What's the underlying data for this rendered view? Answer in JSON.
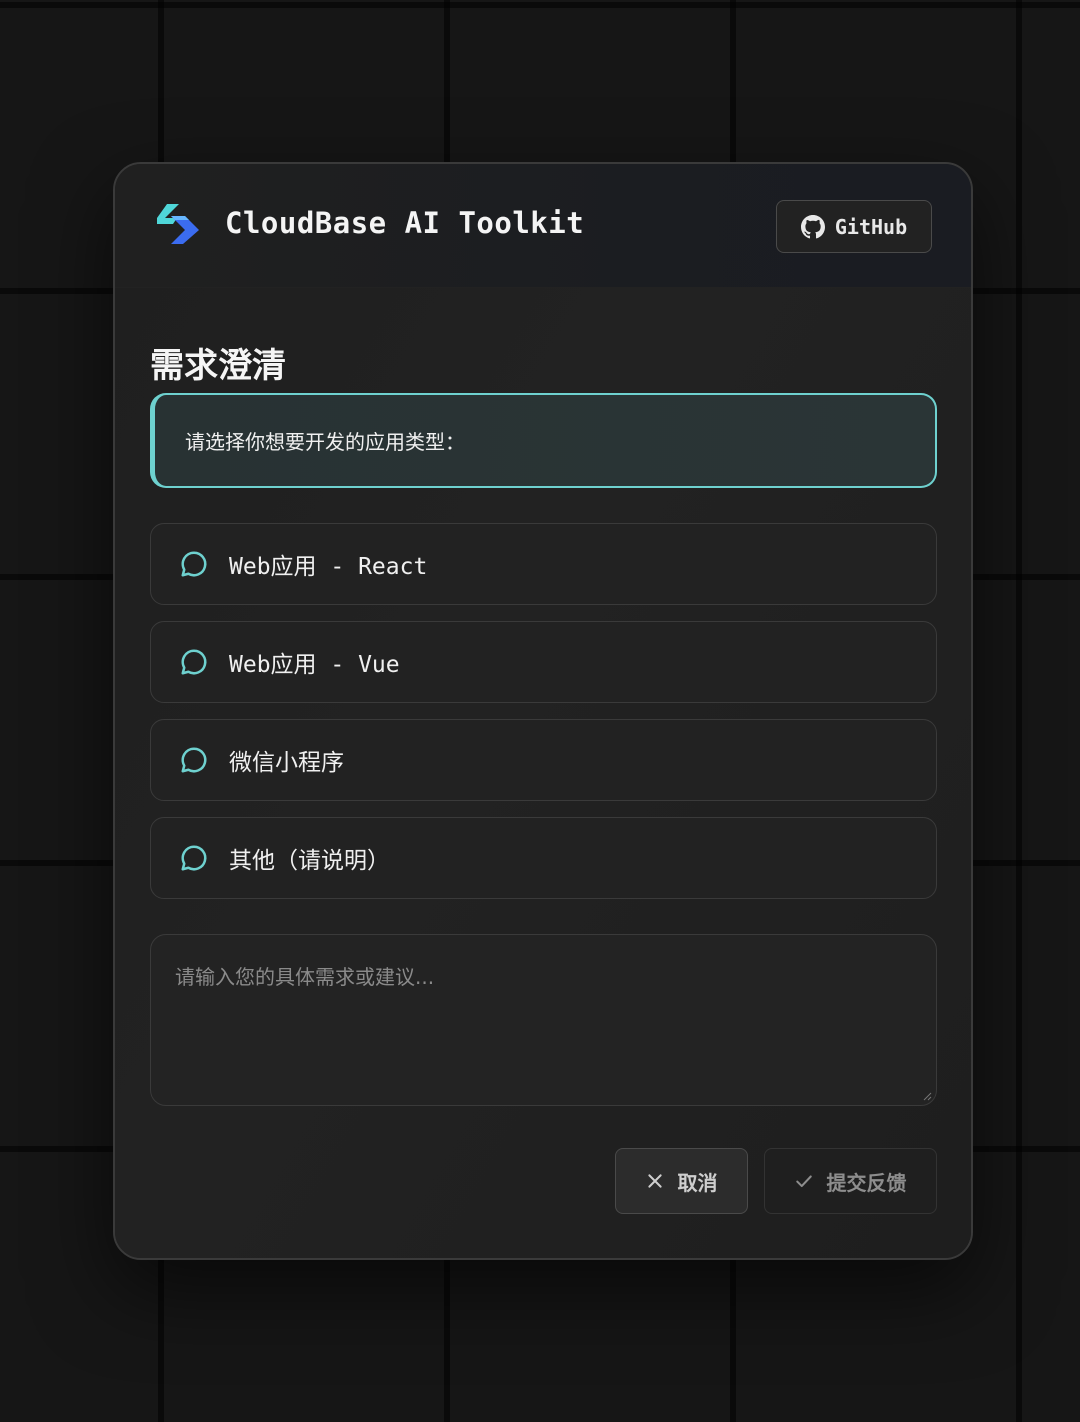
{
  "header": {
    "app_title": "CloudBase AI Toolkit",
    "github_label": "GitHub"
  },
  "main": {
    "section_title": "需求澄清",
    "question": "请选择你想要开发的应用类型：",
    "options": [
      {
        "label": "Web应用 - React",
        "icon": "chat-bubble-icon"
      },
      {
        "label": "Web应用 - Vue",
        "icon": "chat-bubble-icon"
      },
      {
        "label": "微信小程序",
        "icon": "chat-bubble-icon"
      },
      {
        "label": "其他（请说明）",
        "icon": "chat-bubble-icon"
      }
    ],
    "textarea_placeholder": "请输入您的具体需求或建议...",
    "textarea_value": ""
  },
  "actions": {
    "cancel_label": "取消",
    "submit_label": "提交反馈"
  },
  "colors": {
    "accent": "#6ed1cf",
    "logo_primary": "#3b6cf0",
    "logo_secondary": "#4fd6d8"
  }
}
